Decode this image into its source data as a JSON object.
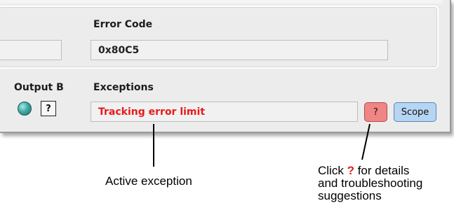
{
  "panel": {
    "error_code_label": "Error Code",
    "error_code_value": "0x80C5",
    "output_b_label": "Output B",
    "output_b_value": "?",
    "exceptions_label": "Exceptions",
    "exceptions_value": "Tracking error limit",
    "help_button_label": "?",
    "scope_button_label": "Scope"
  },
  "annotations": {
    "active_exception": "Active exception",
    "click_prefix": "Click",
    "click_mark": "?",
    "click_suffix": "for details",
    "line2": "and troubleshooting",
    "line3": "suggestions"
  },
  "colors": {
    "exception_text": "#e8191b",
    "help_button": "#f08585",
    "scope_button": "#b6d5f2",
    "led": "#3eaaa6"
  }
}
